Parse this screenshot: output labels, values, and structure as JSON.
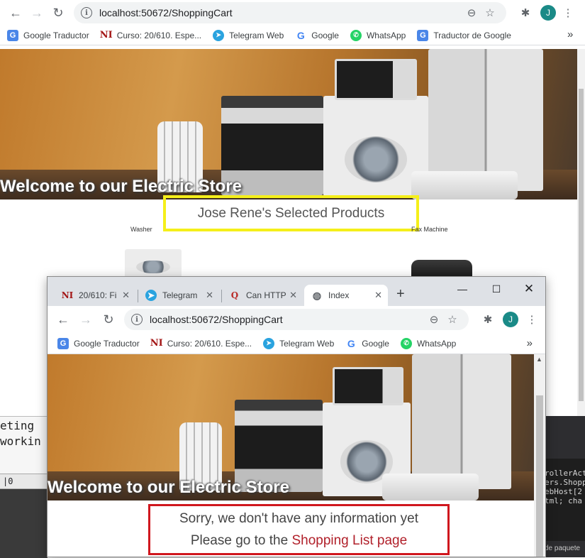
{
  "back_browser": {
    "url": "localhost:50672/ShoppingCart",
    "avatar_letter": "J",
    "bookmarks": [
      {
        "label": "Google Traductor",
        "icon": "google-translate-icon"
      },
      {
        "label": "Curso: 20/610. Espe...",
        "icon": "ni-icon"
      },
      {
        "label": "Telegram Web",
        "icon": "telegram-icon"
      },
      {
        "label": "Google",
        "icon": "google-icon"
      },
      {
        "label": "WhatsApp",
        "icon": "whatsapp-icon"
      },
      {
        "label": "Traductor de Google",
        "icon": "google-translate-icon"
      }
    ],
    "more_bookmarks": "»",
    "hero_title": "Welcome to our Electric Store",
    "selected_heading": "Jose Rene's Selected Products",
    "products": [
      {
        "name": "Washer"
      },
      {
        "name": "Fax Machine"
      }
    ]
  },
  "front_browser": {
    "tabs": [
      {
        "label": "20/610: Fi",
        "icon": "ni-icon"
      },
      {
        "label": "Telegram",
        "icon": "telegram-icon"
      },
      {
        "label": "Can HTTP",
        "icon": "quora-icon"
      },
      {
        "label": "Index",
        "icon": "globe-icon",
        "active": true
      }
    ],
    "new_tab": "+",
    "url": "localhost:50672/ShoppingCart",
    "avatar_letter": "J",
    "bookmarks": [
      {
        "label": "Google Traductor",
        "icon": "google-translate-icon"
      },
      {
        "label": "Curso: 20/610. Espe...",
        "icon": "ni-icon"
      },
      {
        "label": "Telegram Web",
        "icon": "telegram-icon"
      },
      {
        "label": "Google",
        "icon": "google-icon"
      },
      {
        "label": "WhatsApp",
        "icon": "whatsapp-icon"
      }
    ],
    "more_bookmarks": "»",
    "hero_title": "Welcome to our Electric Store",
    "message_line1": "Sorry, we don't have any information yet",
    "message_prefix": "Please go to the ",
    "message_link": "Shopping List page"
  },
  "background_app": {
    "text_line1": "eting",
    "text_line2": "workin",
    "status": "|0",
    "code_lines": [
      "rollerAct",
      "ers.Shopp",
      "ebHost[2",
      "tml; cha"
    ],
    "footer_text": "de paquete"
  },
  "colors": {
    "highlight_yellow": "#f5ef1a",
    "highlight_red": "#d0171e",
    "link_red": "#b1202a",
    "avatar_teal": "#1a8a87"
  }
}
